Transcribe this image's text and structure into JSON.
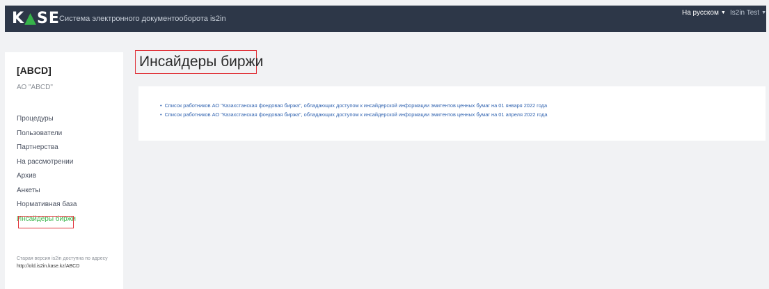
{
  "header": {
    "logo": {
      "part1": "K",
      "part2": "▲",
      "part3": "SE"
    },
    "system_title": "Система электронного документооборота is2in",
    "language": "На русском",
    "user": "Is2in Test"
  },
  "sidebar": {
    "org_code": "[ABCD]",
    "org_name": "АО \"ABCD\"",
    "items": [
      {
        "label": "Процедуры"
      },
      {
        "label": "Пользователи"
      },
      {
        "label": "Партнерства"
      },
      {
        "label": "На рассмотрении"
      },
      {
        "label": "Архив"
      },
      {
        "label": "Анкеты"
      },
      {
        "label": "Нормативная база"
      },
      {
        "label": "Инсайдеры биржи"
      }
    ],
    "note_line1": "Старая версия is2in доступна по адресу",
    "note_url": "http://old.is2in.kase.kz/ABCD"
  },
  "main": {
    "title": "Инсайдеры биржи",
    "documents": [
      {
        "label": "Список работников АО \"Казахстанская фондовая биржа\", обладающих доступом к инсайдерской информации эмитентов ценных бумаг на 01 января 2022 года"
      },
      {
        "label": "Список работников АО \"Казахстанская фондовая биржа\", обладающих доступом к инсайдерской информации эмитентов ценных бумаг на 01 апреля 2022 года"
      }
    ]
  },
  "colors": {
    "topbar": "#2d3748",
    "accent_green": "#39b54a",
    "link_blue": "#3264b0",
    "highlight_red": "#e0333a"
  }
}
